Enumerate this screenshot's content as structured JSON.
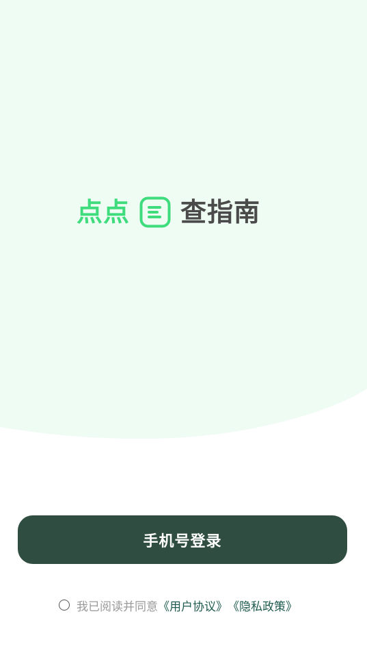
{
  "logo": {
    "left_text": "点点",
    "mark_icon": "chat-list-icon",
    "right_text": "查指南"
  },
  "login": {
    "button_label": "手机号登录"
  },
  "agreement": {
    "prefix": "我已阅读并同意",
    "user_agreement": "《用户协议》",
    "privacy_policy": "《隐私政策》",
    "checked": false
  },
  "colors": {
    "hero_background": "#eefcf3",
    "brand_green": "#3fdc7e",
    "button_dark_green": "#2f4d40",
    "link_color": "#1f5b4e"
  }
}
